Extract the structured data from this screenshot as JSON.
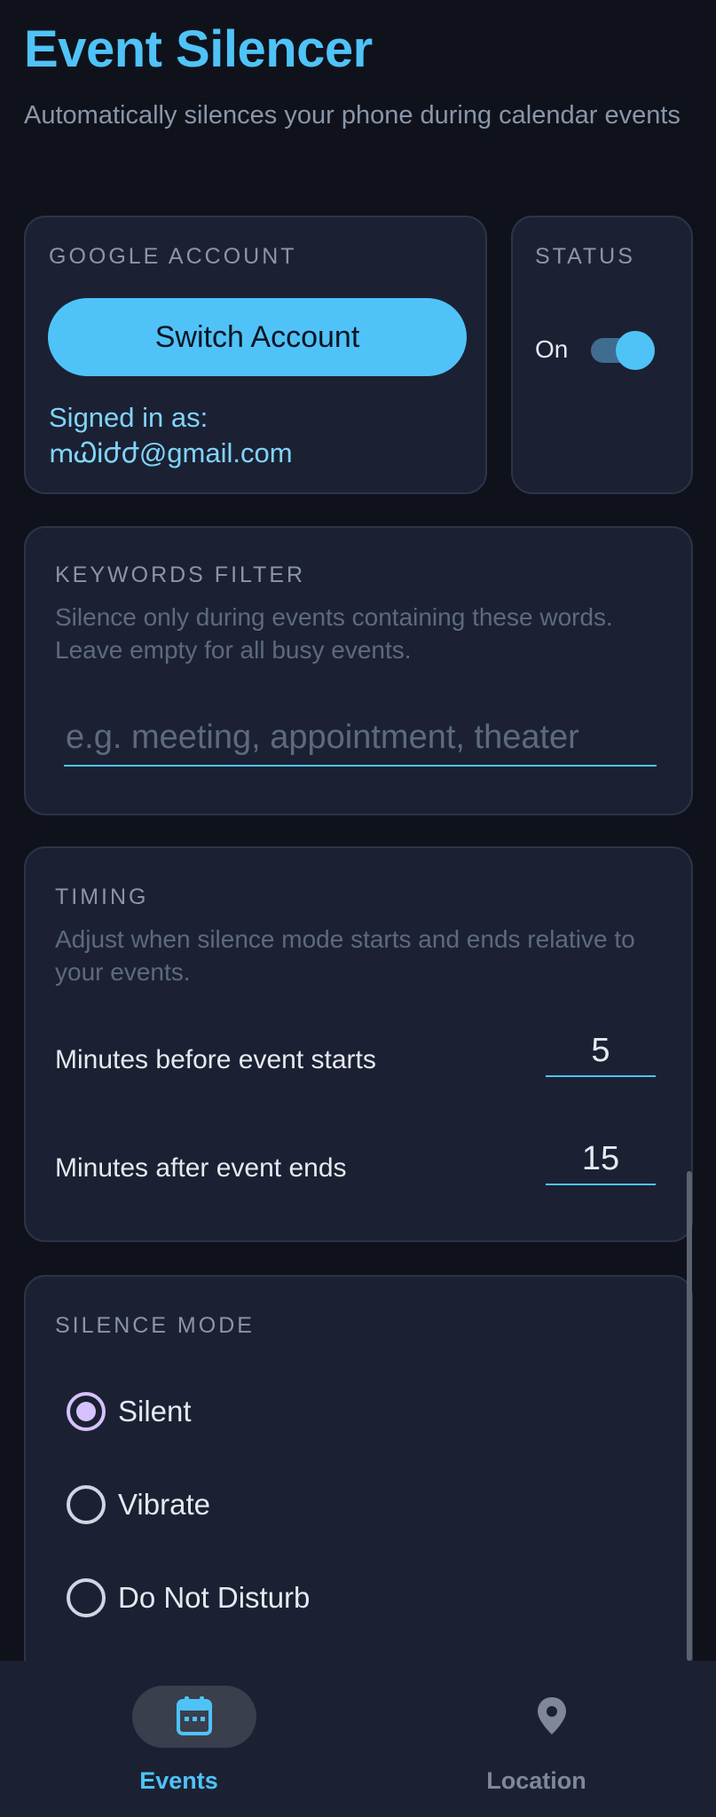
{
  "app": {
    "title": "Event Silencer",
    "subtitle": "Automatically silences your phone during calendar events"
  },
  "account": {
    "section_label": "GOOGLE ACCOUNT",
    "switch_label": "Switch Account",
    "signed_in_label": "Signed in as:",
    "email": "ՠᏇᎥժժ@gmail.com"
  },
  "status": {
    "section_label": "STATUS",
    "state_label": "On",
    "enabled": true
  },
  "keywords": {
    "section_label": "KEYWORDS FILTER",
    "description": "Silence only during events containing these words. Leave empty for all busy events.",
    "placeholder": "e.g. meeting, appointment, theater",
    "value": ""
  },
  "timing": {
    "section_label": "TIMING",
    "description": "Adjust when silence mode starts and ends relative to your events.",
    "before_label": "Minutes before event starts",
    "before_value": "5",
    "after_label": "Minutes after event ends",
    "after_value": "15"
  },
  "silence_mode": {
    "section_label": "SILENCE MODE",
    "options": [
      {
        "label": "Silent",
        "selected": true
      },
      {
        "label": "Vibrate",
        "selected": false
      },
      {
        "label": "Do Not Disturb",
        "selected": false
      }
    ]
  },
  "bottom_nav": {
    "items": [
      {
        "label": "Events",
        "icon": "calendar-icon",
        "active": true
      },
      {
        "label": "Location",
        "icon": "location-pin-icon",
        "active": false
      }
    ]
  },
  "colors": {
    "background": "#0f121b",
    "card": "#1b2133",
    "accent": "#4fc3f7",
    "radio_selected": "#d6c2ff",
    "muted_text": "#8a96a8"
  }
}
